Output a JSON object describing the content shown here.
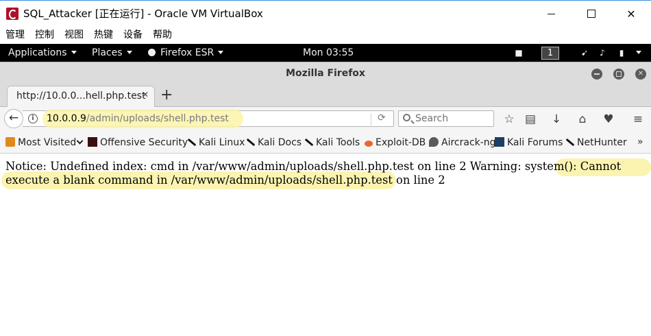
{
  "vbox": {
    "title": "SQL_Attacker [正在运行] - Oracle VM VirtualBox",
    "menu": [
      "管理",
      "控制",
      "视图",
      "热键",
      "设备",
      "帮助"
    ]
  },
  "gnome_bar": {
    "applications": "Applications",
    "places": "Places",
    "firefox": "Firefox ESR",
    "clock": "Mon 03:55",
    "workspace": "1"
  },
  "firefox": {
    "window_title": "Mozilla Firefox",
    "tab_label": "http://10.0.0...hell.php.test",
    "url_host": "10.0.0.9",
    "url_path": "/admin/uploads/shell.php.test",
    "search_placeholder": "Search",
    "bookmarks": [
      "Most Visited",
      "Offensive Security",
      "Kali Linux",
      "Kali Docs",
      "Kali Tools",
      "Exploit-DB",
      "Aircrack-ng",
      "Kali Forums",
      "NetHunter"
    ],
    "bookmarks_more": "»"
  },
  "page": {
    "message": "Notice: Undefined index: cmd in /var/www/admin/uploads/shell.php.test on line 2 Warning: system(): Cannot execute a blank command in /var/www/admin/uploads/shell.php.test on line 2"
  },
  "icons": {
    "close": "✕",
    "new_tab": "+",
    "back": "←",
    "reload": "⟳"
  },
  "colors": {
    "highlight": "#fbf3a8",
    "gnome_bar": "#000000",
    "firefox_chrome": "#dcdcdc"
  }
}
